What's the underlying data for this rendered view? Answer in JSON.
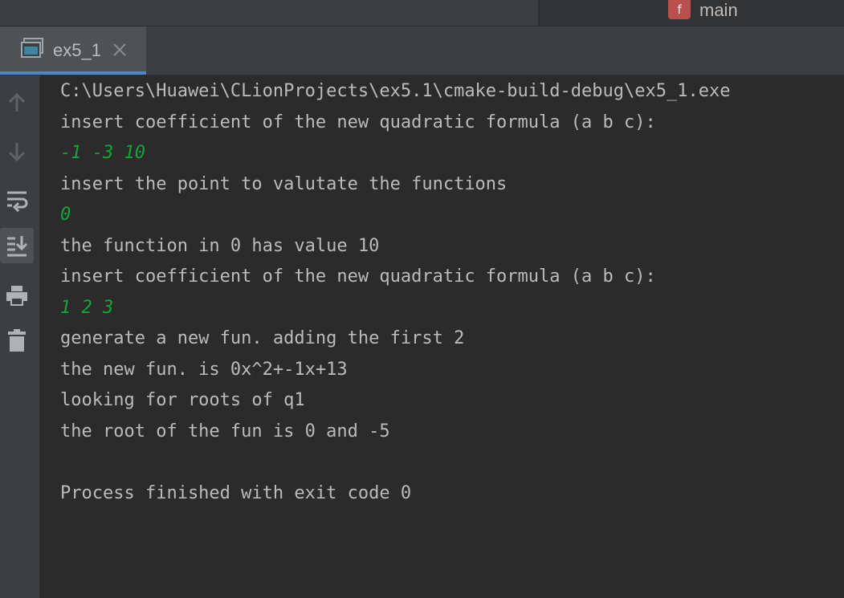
{
  "run_config": {
    "badge": "f",
    "name": "main"
  },
  "tab": {
    "label": "ex5_1",
    "close_icon": "close-icon",
    "icon": "console-window-icon"
  },
  "toolbar": {
    "buttons": [
      {
        "icon": "arrow-up-icon"
      },
      {
        "icon": "arrow-down-icon"
      },
      {
        "icon": "soft-wrap-icon"
      },
      {
        "icon": "scroll-to-end-icon",
        "active": true
      },
      {
        "icon": "print-icon"
      },
      {
        "icon": "trash-icon"
      }
    ]
  },
  "console": {
    "lines": [
      {
        "text": "C:\\Users\\Huawei\\CLionProjects\\ex5.1\\cmake-build-debug\\ex5_1.exe",
        "kind": "output"
      },
      {
        "text": "insert coefficient of the new quadratic formula (a b c):",
        "kind": "output"
      },
      {
        "text": "-1 -3 10",
        "kind": "input"
      },
      {
        "text": "insert the point to valutate the functions",
        "kind": "output"
      },
      {
        "text": "0",
        "kind": "input"
      },
      {
        "text": "the function in 0 has value 10",
        "kind": "output"
      },
      {
        "text": "insert coefficient of the new quadratic formula (a b c):",
        "kind": "output"
      },
      {
        "text": "1 2 3",
        "kind": "input"
      },
      {
        "text": "generate a new fun. adding the first 2",
        "kind": "output"
      },
      {
        "text": "the new fun. is 0x^2+-1x+13",
        "kind": "output"
      },
      {
        "text": "looking for roots of q1",
        "kind": "output"
      },
      {
        "text": "the root of the fun is 0 and -5",
        "kind": "output"
      },
      {
        "text": "",
        "kind": "output"
      },
      {
        "text": "Process finished with exit code 0",
        "kind": "output"
      }
    ]
  },
  "colors": {
    "background": "#2b2b2b",
    "text": "#bbbbbb",
    "user_input": "#15a33a",
    "tab_underline": "#4a88c7"
  }
}
